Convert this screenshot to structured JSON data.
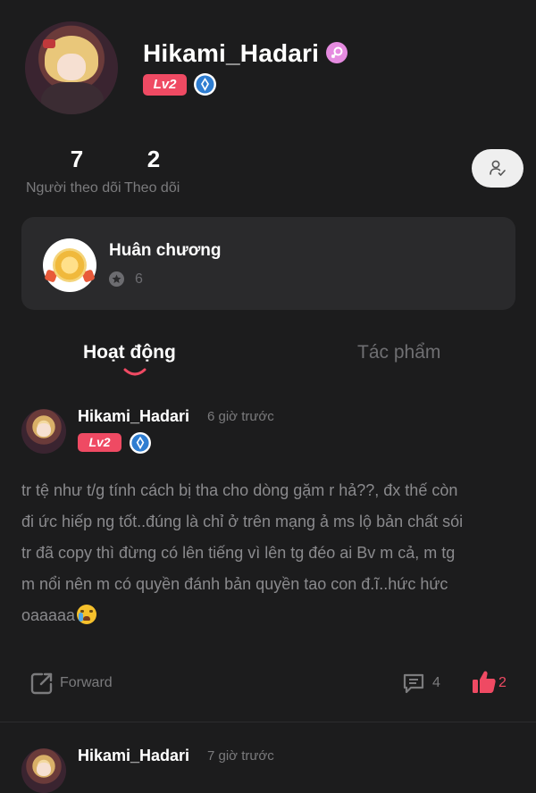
{
  "profile": {
    "username": "Hikami_Hadari",
    "level": "Lv2",
    "gender_icon": "female-icon",
    "verified_icon": "shield-icon",
    "followers": {
      "count": "7",
      "label": "Người theo dõi"
    },
    "following": {
      "count": "2",
      "label": "Theo dõi"
    },
    "follow_button_icon": "add-user-icon"
  },
  "medals": {
    "title": "Huân chương",
    "count": "6",
    "icon": "medal-icon"
  },
  "tabs": [
    {
      "label": "Hoạt động",
      "active": true
    },
    {
      "label": "Tác phẩm",
      "active": false
    }
  ],
  "posts": [
    {
      "author": "Hikami_Hadari",
      "time": "6 giờ trước",
      "level": "Lv2",
      "text_lines": [
        "tr tệ như t/g tính cách bị tha cho dòng gặm r hả??, đx thế còn",
        "đi ức hiếp ng tốt..đúng là chỉ ở trên mạng ả ms lộ bản chất sói",
        "tr đã copy thì đừng có lên tiếng vì lên tg đéo ai Bv m cả, m tg",
        "m nổi nên m có quyền đánh bản quyền tao con đ.ĩ..hức hức",
        "oaaaaa"
      ],
      "emoji": "crying-face",
      "forward_label": "Forward",
      "comments": "4",
      "likes": "2"
    },
    {
      "author": "Hikami_Hadari",
      "time": "7 giờ trước"
    }
  ],
  "colors": {
    "background": "#1c1c1d",
    "card": "#2a2a2c",
    "accent": "#ef4a63",
    "muted": "#7b7b7d"
  }
}
